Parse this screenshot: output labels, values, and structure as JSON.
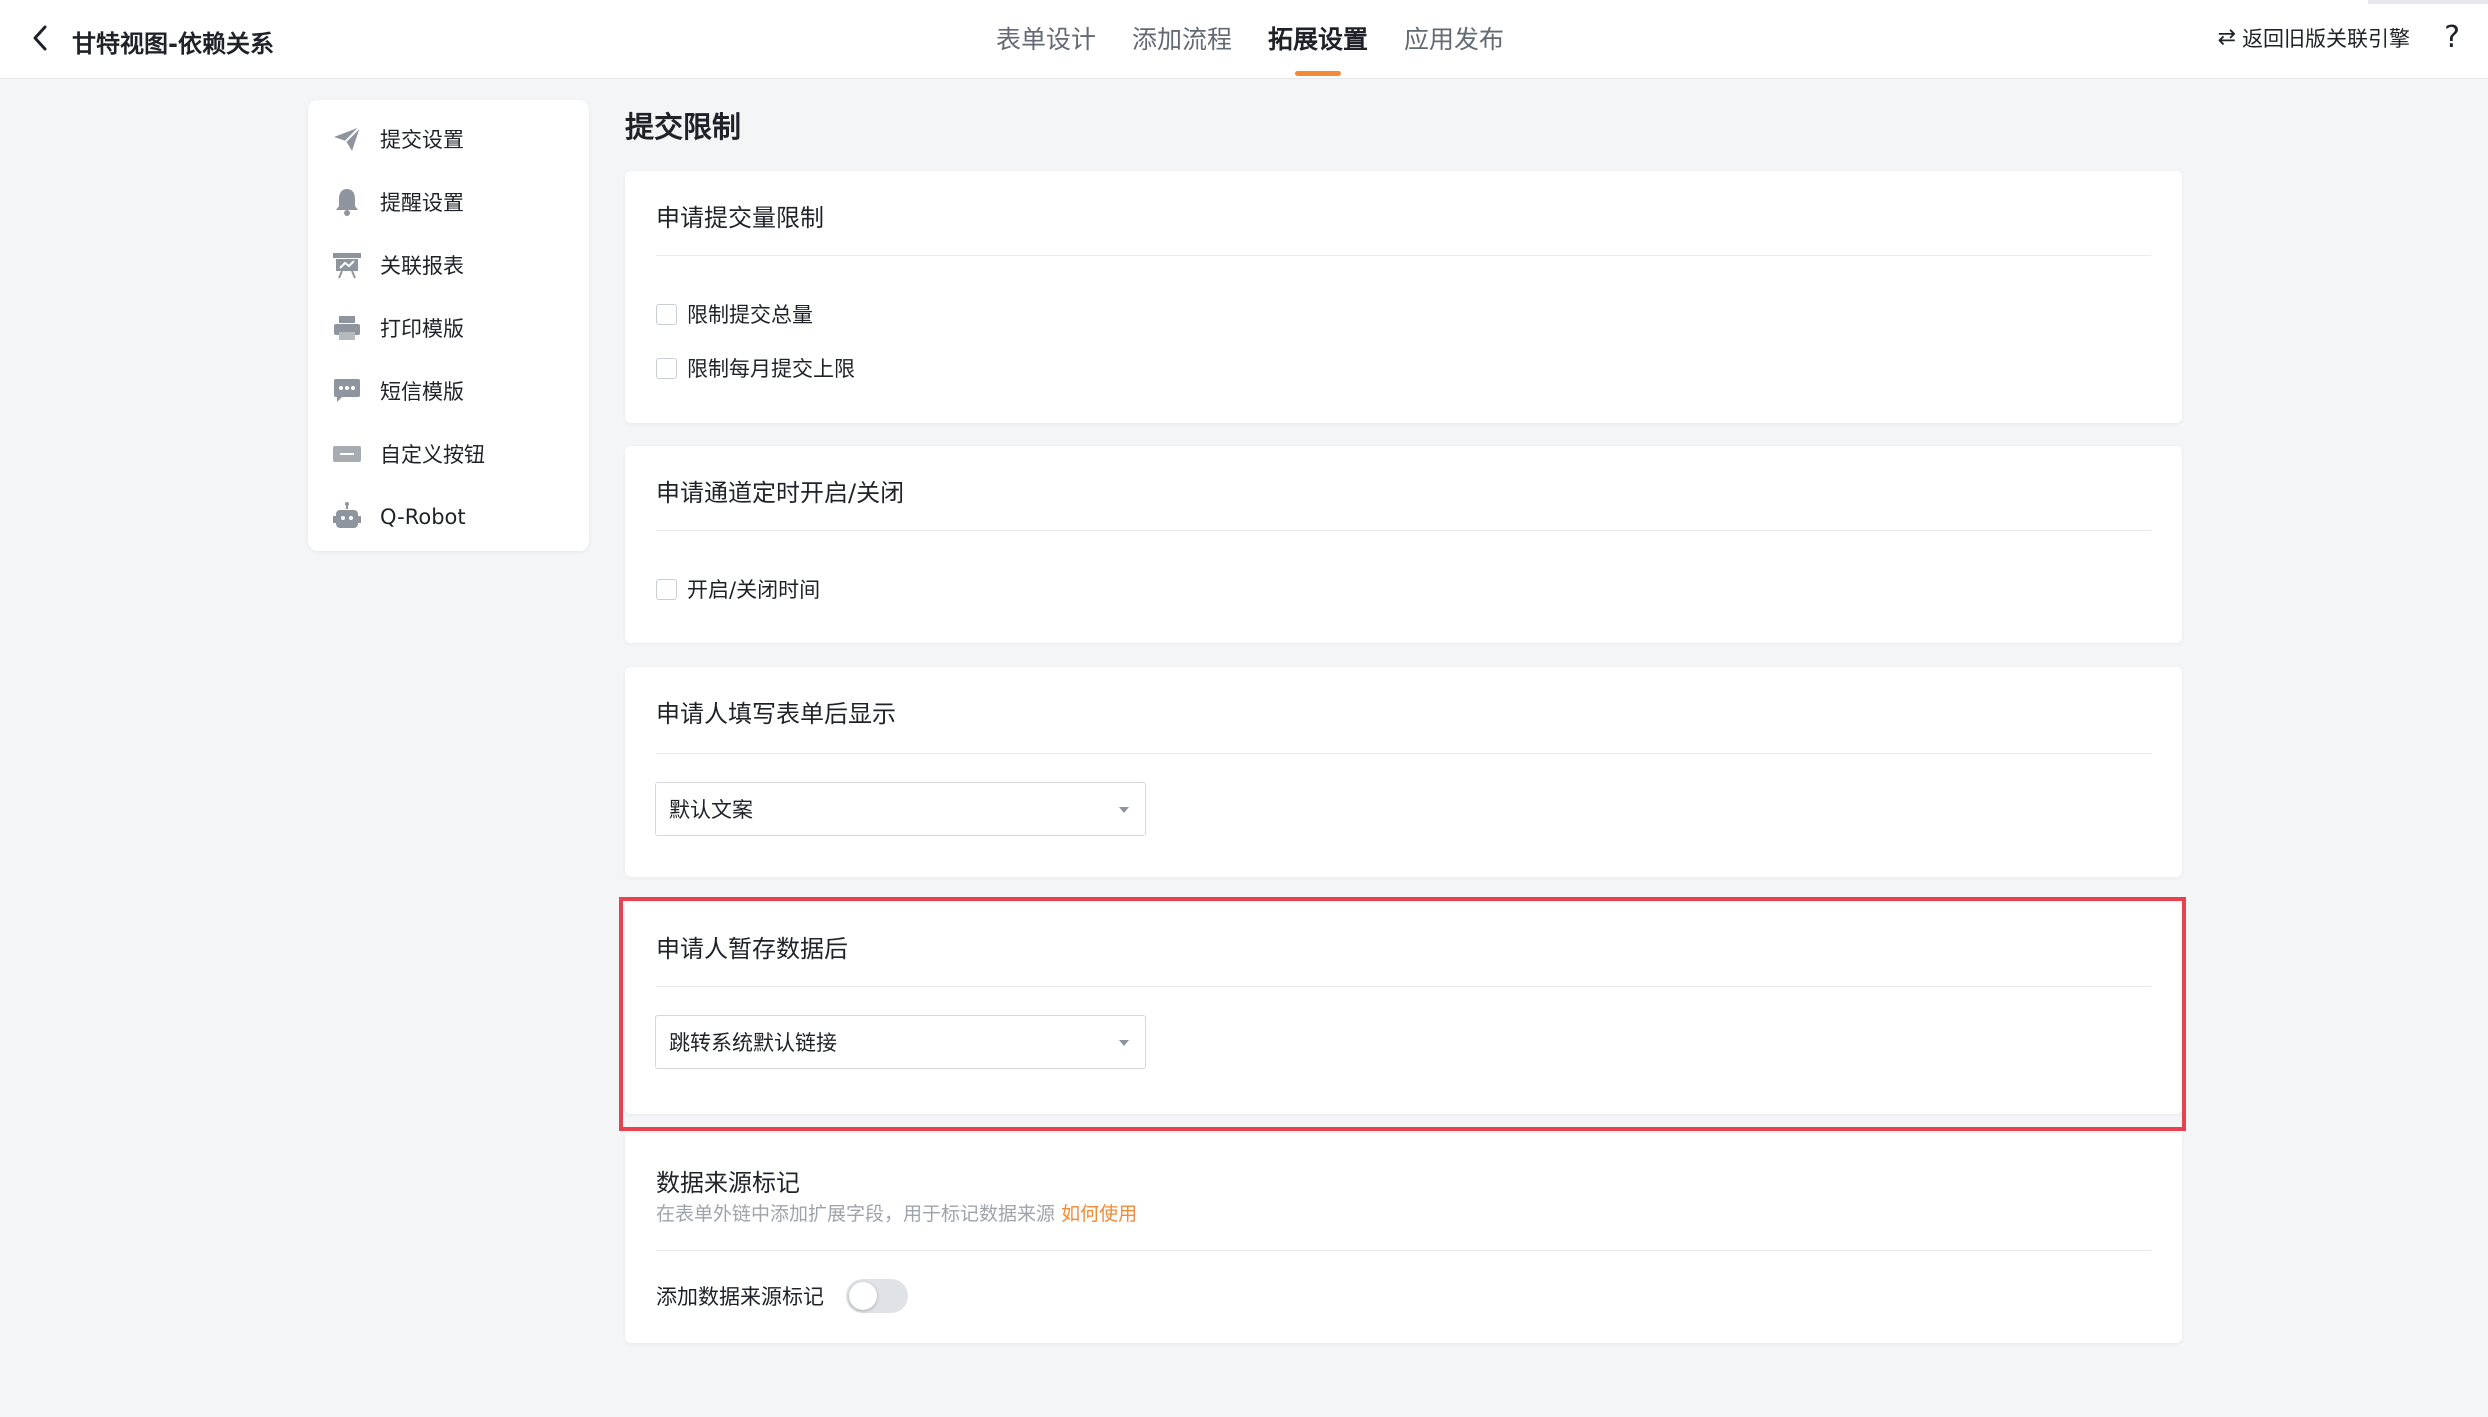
{
  "header": {
    "title": "甘特视图-依赖关系",
    "tabs": [
      {
        "label": "表单设计",
        "active": false
      },
      {
        "label": "添加流程",
        "active": false
      },
      {
        "label": "拓展设置",
        "active": true
      },
      {
        "label": "应用发布",
        "active": false
      }
    ],
    "old_version_link": "返回旧版关联引擎",
    "help": "?"
  },
  "sidebar": {
    "items": [
      {
        "label": "提交设置",
        "icon": "paper-plane-icon"
      },
      {
        "label": "提醒设置",
        "icon": "bell-icon"
      },
      {
        "label": "关联报表",
        "icon": "report-icon"
      },
      {
        "label": "打印模版",
        "icon": "printer-icon"
      },
      {
        "label": "短信模版",
        "icon": "message-icon"
      },
      {
        "label": "自定义按钮",
        "icon": "button-icon"
      },
      {
        "label": "Q-Robot",
        "icon": "robot-icon"
      }
    ]
  },
  "main": {
    "section_title": "提交限制",
    "submission_limit": {
      "title": "申请提交量限制",
      "options": [
        "限制提交总量",
        "限制每月提交上限"
      ]
    },
    "channel_schedule": {
      "title": "申请通道定时开启/关闭",
      "option": "开启/关闭时间"
    },
    "after_submit": {
      "title": "申请人填写表单后显示",
      "selected": "默认文案"
    },
    "after_save": {
      "title": "申请人暂存数据后",
      "selected": "跳转系统默认链接"
    },
    "data_source": {
      "title": "数据来源标记",
      "subtitle": "在表单外链中添加扩展字段，用于标记数据来源",
      "link": "如何使用",
      "toggle_label": "添加数据来源标记",
      "toggle_on": false
    }
  },
  "colors": {
    "accent": "#f48a36",
    "highlight": "#e5434f",
    "background": "#f4f5f7"
  }
}
